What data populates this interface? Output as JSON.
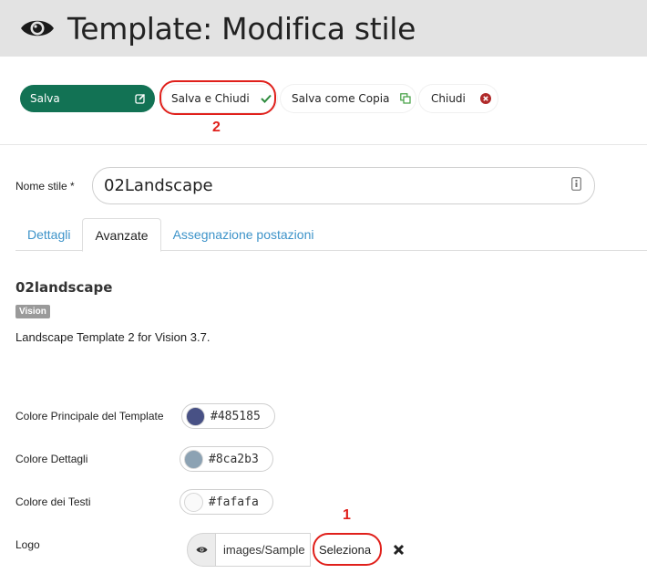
{
  "header": {
    "title": "Template: Modifica stile",
    "icon": "eye-icon"
  },
  "toolbar": {
    "save_label": "Salva",
    "save_close_label": "Salva e Chiudi",
    "save_copy_label": "Salva come Copia",
    "close_label": "Chiudi"
  },
  "annotations": {
    "marker_1": "1",
    "marker_2": "2"
  },
  "form": {
    "name_label": "Nome stile *",
    "name_value": "02Landscape"
  },
  "tabs": [
    {
      "label": "Dettagli"
    },
    {
      "label": "Avanzate"
    },
    {
      "label": "Assegnazione postazioni"
    }
  ],
  "template": {
    "title": "02landscape",
    "badge": "Vision",
    "description": "Landscape Template 2 for Vision 3.7."
  },
  "colors": {
    "main_label": "Colore Principale del Template",
    "main_value": "#485185",
    "details_label": "Colore Dettagli",
    "details_value": "#8ca2b3",
    "text_label": "Colore dei Testi",
    "text_value": "#fafafa"
  },
  "logo": {
    "label": "Logo",
    "path_value": "images/Sample",
    "select_label": "Seleziona"
  },
  "theme": {
    "primary": "#127254",
    "link": "#3d93c9",
    "annotation": "#e0201b"
  }
}
